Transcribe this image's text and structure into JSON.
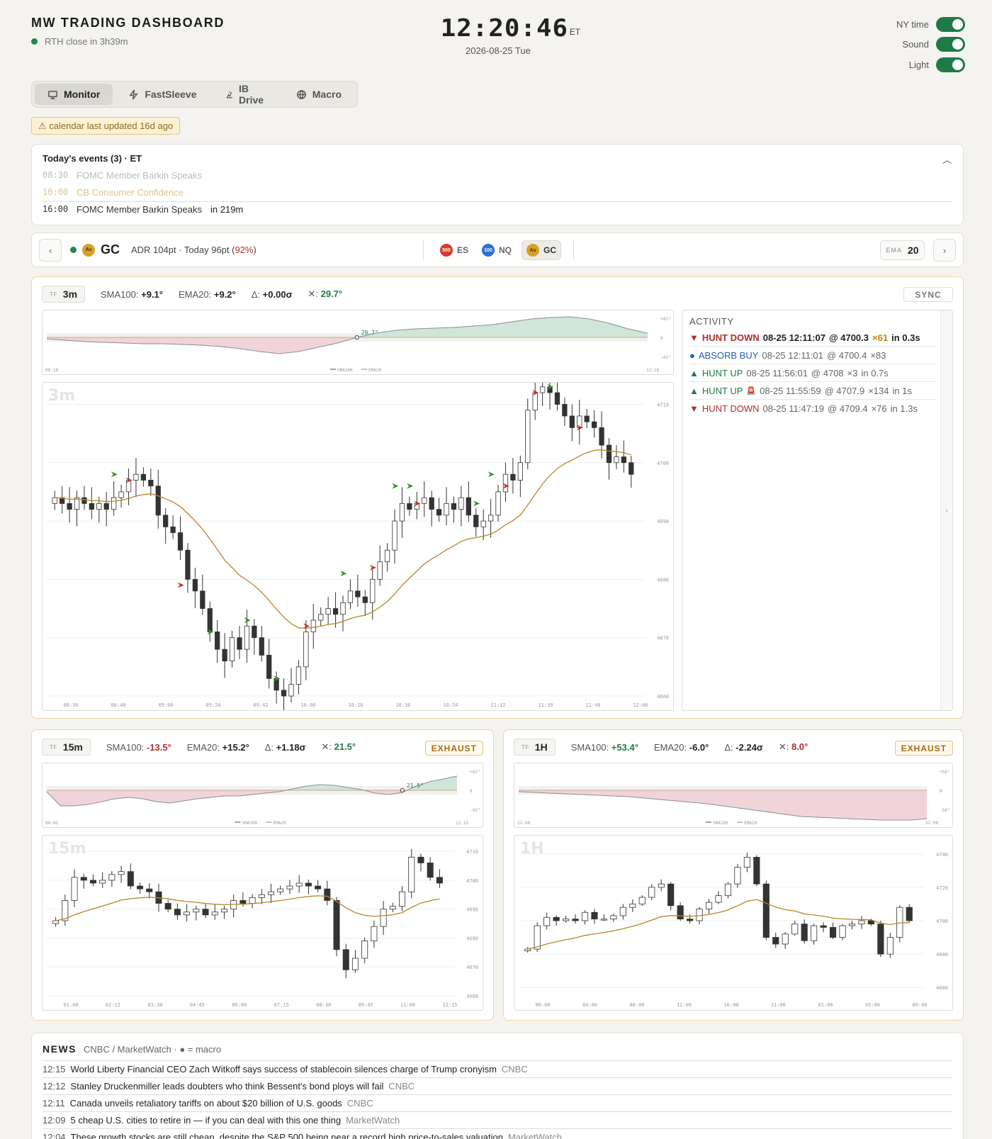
{
  "header": {
    "title": "MW TRADING DASHBOARD",
    "status": "RTH close in 3h39m",
    "clock_time": "12:20:46",
    "clock_tz": "ET",
    "clock_date": "2026-08-25 Tue",
    "toggles": [
      {
        "label": "NY time",
        "on": true
      },
      {
        "label": "Sound",
        "on": true
      },
      {
        "label": "Light",
        "on": true
      }
    ]
  },
  "tabs": [
    {
      "label": "Monitor",
      "icon": "monitor-icon",
      "active": true
    },
    {
      "label": "FastSleeve",
      "icon": "bolt-icon",
      "active": false
    },
    {
      "label": "IB Drive",
      "icon": "drive-icon",
      "active": false
    },
    {
      "label": "Macro",
      "icon": "globe-icon",
      "active": false
    }
  ],
  "warning": "⚠ calendar last updated 16d ago",
  "events": {
    "title": "Today's events (3) · ET",
    "items": [
      {
        "time": "08:30",
        "name": "FOMC Member Barkin Speaks",
        "note": "",
        "state": "past"
      },
      {
        "time": "10:00",
        "name": "CB Consumer Confidence",
        "note": "",
        "state": "past-highlight"
      },
      {
        "time": "16:00",
        "name": "FOMC Member Barkin Speaks",
        "note": "in 219m",
        "state": "upcoming"
      }
    ]
  },
  "symbol_bar": {
    "symbol": "GC",
    "coin": "Au",
    "adr_text": "ADR 104pt · Today 96pt (",
    "adr_pct": "92%",
    "adr_close": ")",
    "chips": [
      {
        "label": "ES",
        "coin": "500"
      },
      {
        "label": "NQ",
        "coin": "100"
      },
      {
        "label": "GC",
        "coin": "Au"
      }
    ],
    "ema_label": "EMA",
    "ema_value": "20",
    "prev": "‹",
    "next": "›"
  },
  "panels": {
    "m3": {
      "tf_label": "TF",
      "tf": "3m",
      "sma_label": "SMA100:",
      "sma": "+9.1°",
      "ema_label": "EMA20:",
      "ema": "+9.2°",
      "delta_label": "Δ:",
      "delta": "+0.00σ",
      "cross_label": "✕:",
      "cross": "29.7°",
      "sync": "SYNC",
      "watermark": "3m",
      "osc_value": "29.7°",
      "osc_ticks": [
        "+43°",
        "0",
        "-43°"
      ],
      "osc_x": [
        "08:18",
        "12:18"
      ],
      "legend": [
        "SMA100",
        "EMA20"
      ],
      "y_ticks": [
        "4710",
        "4700",
        "4690",
        "4680",
        "4670",
        "4660"
      ],
      "x_ticks": [
        "08:30",
        "08:48",
        "09:06",
        "09:24",
        "09:42",
        "10:00",
        "10:18",
        "10:36",
        "10:54",
        "11:12",
        "11:30",
        "11:48",
        "12:06"
      ]
    },
    "m15": {
      "tf_label": "TF",
      "tf": "15m",
      "sma_label": "SMA100:",
      "sma": "-13.5°",
      "ema_label": "EMA20:",
      "ema": "+15.2°",
      "delta_label": "Δ:",
      "delta": "+1.18σ",
      "cross_label": "✕:",
      "cross": "21.5°",
      "badge": "EXHAUST",
      "watermark": "15m",
      "osc_value": "21.5°",
      "osc_ticks": [
        "+42°",
        "0",
        "-42°"
      ],
      "osc_x": [
        "00:45",
        "12:15"
      ],
      "legend": [
        "SMA100",
        "EMA20"
      ],
      "y_ticks": [
        "4710",
        "4700",
        "4690",
        "4680",
        "4670",
        "4660"
      ],
      "x_ticks": [
        "01:00",
        "02:15",
        "03:30",
        "04:45",
        "06:00",
        "07:15",
        "08:30",
        "09:45",
        "11:00",
        "12:15"
      ]
    },
    "h1": {
      "tf_label": "TF",
      "tf": "1H",
      "sma_label": "SMA100:",
      "sma": "+53.4°",
      "ema_label": "EMA20:",
      "ema": "-6.0°",
      "delta_label": "Δ:",
      "delta": "-2.24σ",
      "cross_label": "✕:",
      "cross": "8.0°",
      "badge": "EXHAUST",
      "watermark": "1H",
      "osc_ticks": [
        "+56°",
        "0",
        "-56°"
      ],
      "osc_x": [
        "21:00",
        "12:00"
      ],
      "legend": [
        "SMA100",
        "EMA20"
      ],
      "y_ticks": [
        "4740",
        "4720",
        "4700",
        "4680",
        "4660"
      ],
      "x_ticks": [
        "00:00",
        "04:00",
        "08:00",
        "12:00",
        "16:00",
        "21:00",
        "01:00",
        "05:00",
        "09:00"
      ]
    }
  },
  "activity": {
    "title": "ACTIVITY",
    "items": [
      {
        "icon": "▼",
        "label": "HUNT DOWN",
        "kind": "down",
        "time": "08-25 12:11:07",
        "price": "@ 4700.3",
        "size": "×61",
        "dur": "in 0.3s",
        "bold": true
      },
      {
        "icon": "●",
        "label": "ABSORB BUY",
        "kind": "absorb",
        "time": "08-25 12:11:01",
        "price": "@ 4700.4",
        "size": "×83",
        "dur": "",
        "bold": false
      },
      {
        "icon": "▲",
        "label": "HUNT UP",
        "kind": "up",
        "time": "08-25 11:56:01",
        "price": "@ 4708",
        "size": "×3",
        "dur": "in 0.7s",
        "bold": false
      },
      {
        "icon": "▲",
        "label": "HUNT UP",
        "kind": "up",
        "time": "08-25 11:55:59",
        "price": "@ 4707.9",
        "size": "×134",
        "dur": "in 1s",
        "bold": false,
        "alert": "🚨"
      },
      {
        "icon": "▼",
        "label": "HUNT DOWN",
        "kind": "down",
        "time": "08-25 11:47:19",
        "price": "@ 4709.4",
        "size": "×76",
        "dur": "in 1.3s",
        "bold": false
      }
    ]
  },
  "news": {
    "title": "NEWS",
    "sources": "CNBC / MarketWatch · ● = macro",
    "items": [
      {
        "time": "12:15",
        "headline": "World Liberty Financial CEO Zach Witkoff says success of stablecoin silences charge of Trump cronyism",
        "source": "CNBC"
      },
      {
        "time": "12:12",
        "headline": "Stanley Druckenmiller leads doubters who think Bessent's bond ploys will fail",
        "source": "CNBC"
      },
      {
        "time": "12:11",
        "headline": "Canada unveils retaliatory tariffs on about $20 billion of U.S. goods",
        "source": "CNBC"
      },
      {
        "time": "12:09",
        "headline": "5 cheap U.S. cities to retire in — if you can deal with this one thing",
        "source": "MarketWatch"
      },
      {
        "time": "12:04",
        "headline": "These growth stocks are still cheap, despite the S&P 500 being near a record high price-to-sales valuation",
        "source": "MarketWatch"
      }
    ]
  },
  "chart_data": [
    {
      "type": "candlestick",
      "title": "3m",
      "x_ticks": [
        "08:30",
        "08:48",
        "09:06",
        "09:24",
        "09:42",
        "10:00",
        "10:18",
        "10:36",
        "10:54",
        "11:12",
        "11:30",
        "11:48",
        "12:06"
      ],
      "ylim": [
        4660,
        4712
      ],
      "closes": [
        4694,
        4693,
        4692,
        4694,
        4693,
        4692,
        4693,
        4692,
        4694,
        4695,
        4697,
        4698,
        4697,
        4696,
        4691,
        4689,
        4688,
        4685,
        4680,
        4678,
        4675,
        4671,
        4668,
        4666,
        4670,
        4668,
        4672,
        4670,
        4667,
        4663,
        4661,
        4660,
        4662,
        4665,
        4671,
        4673,
        4674,
        4675,
        4674,
        4676,
        4678,
        4677,
        4676,
        4680,
        4683,
        4685,
        4690,
        4693,
        4692,
        4693,
        4694,
        4692,
        4691,
        4693,
        4692,
        4694,
        4691,
        4689,
        4690,
        4691,
        4695,
        4698,
        4697,
        4700,
        4709,
        4712,
        4713,
        4712,
        4710,
        4708,
        4706,
        4708,
        4707,
        4706,
        4703,
        4700,
        4701,
        4700,
        4698
      ],
      "series": [
        {
          "name": "EMA20"
        }
      ]
    },
    {
      "type": "candlestick",
      "title": "15m",
      "x_ticks": [
        "01:00",
        "02:15",
        "03:30",
        "04:45",
        "06:00",
        "07:15",
        "08:30",
        "09:45",
        "11:00",
        "12:15"
      ],
      "ylim": [
        4660,
        4712
      ],
      "closes": [
        4686,
        4693,
        4701,
        4700,
        4699,
        4700,
        4702,
        4703,
        4698,
        4697,
        4696,
        4692,
        4690,
        4688,
        4689,
        4690,
        4688,
        4689,
        4690,
        4693,
        4692,
        4694,
        4695,
        4696,
        4697,
        4698,
        4699,
        4698,
        4697,
        4693,
        4676,
        4669,
        4673,
        4679,
        4684,
        4690,
        4691,
        4696,
        4708,
        4706,
        4701,
        4699
      ],
      "series": [
        {
          "name": "EMA20"
        }
      ]
    },
    {
      "type": "candlestick",
      "title": "1H",
      "x_ticks": [
        "00:00",
        "04:00",
        "08:00",
        "12:00",
        "16:00",
        "21:00",
        "01:00",
        "05:00",
        "09:00"
      ],
      "ylim": [
        4655,
        4745
      ],
      "closes": [
        4683,
        4697,
        4702,
        4700,
        4701,
        4700,
        4705,
        4701,
        4701,
        4703,
        4708,
        4710,
        4714,
        4720,
        4722,
        4709,
        4701,
        4700,
        4707,
        4711,
        4715,
        4722,
        4732,
        4738,
        4722,
        4690,
        4686,
        4692,
        4698,
        4688,
        4697,
        4696,
        4690,
        4697,
        4698,
        4700,
        4698,
        4680,
        4690,
        4708,
        4700
      ],
      "series": [
        {
          "name": "EMA20"
        }
      ]
    }
  ]
}
